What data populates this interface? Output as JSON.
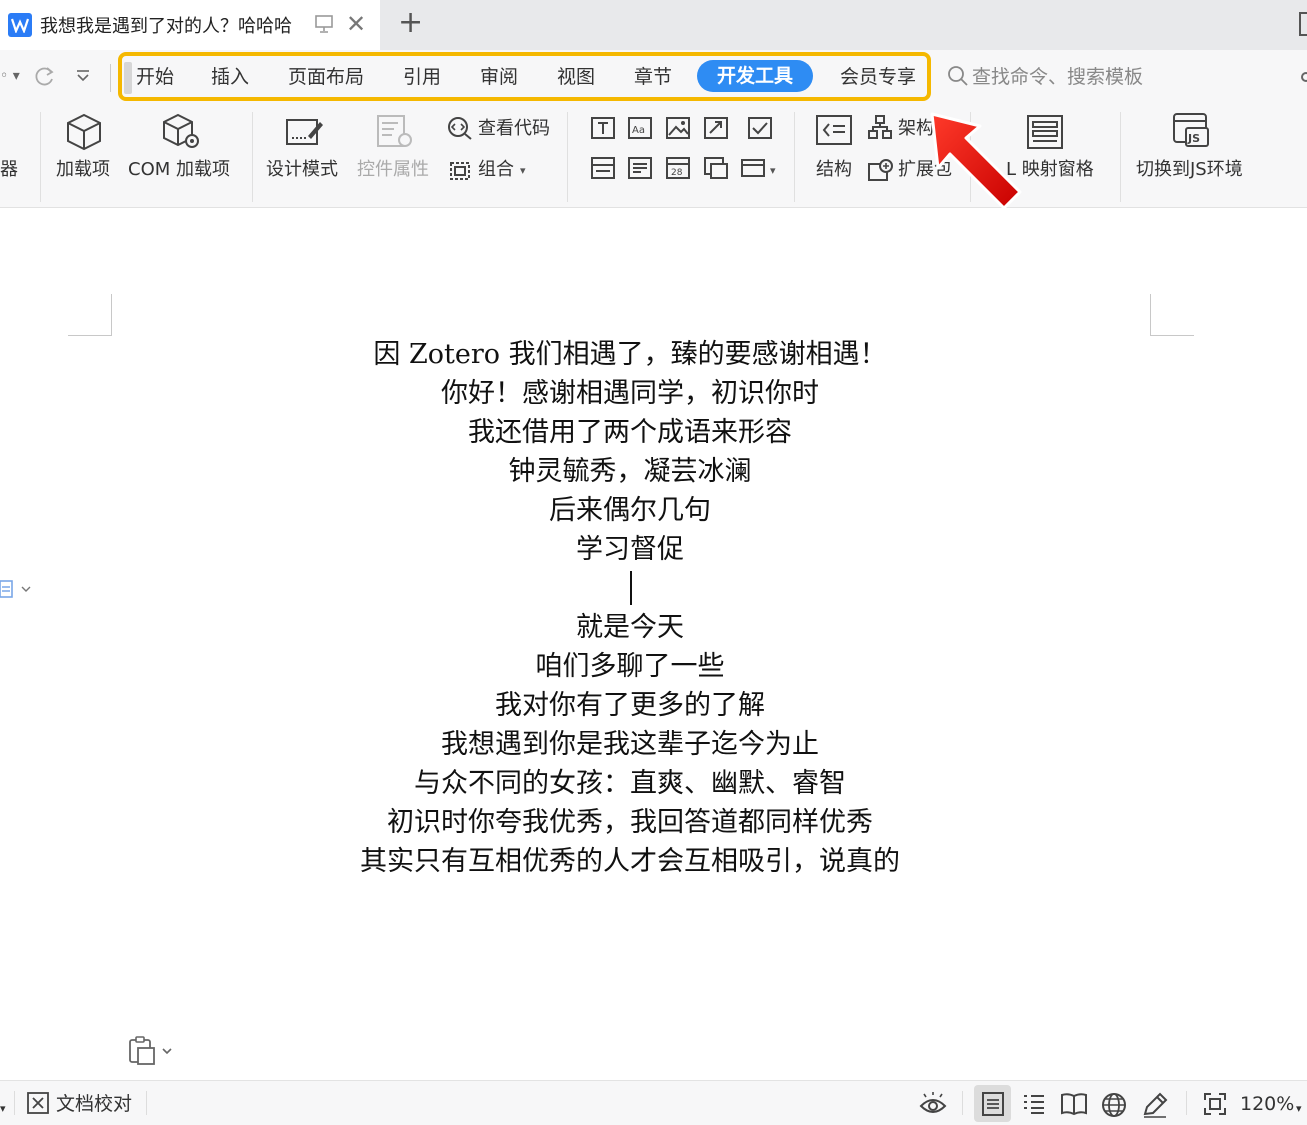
{
  "titlebar": {
    "doc_title": "我想我是遇到了对的人？哈哈哈",
    "app_icon_letter": "W"
  },
  "menu": {
    "items": [
      {
        "label": "开始"
      },
      {
        "label": "插入"
      },
      {
        "label": "页面布局"
      },
      {
        "label": "引用"
      },
      {
        "label": "审阅"
      },
      {
        "label": "视图"
      },
      {
        "label": "章节"
      },
      {
        "label": "开发工具",
        "active": true
      },
      {
        "label": "会员专享"
      }
    ],
    "search_placeholder": "查找命令、搜索模板"
  },
  "ribbon": {
    "left_partial": "器",
    "addins": "加载项",
    "com_addins": "COM 加载项",
    "design_mode": "设计模式",
    "control_props": "控件属性",
    "view_code": "查看代码",
    "group": "组合",
    "structure": "结构",
    "schema": "架构",
    "expansion_pack": "扩展包",
    "xml_pane": "L 映射窗格",
    "switch_js": "切换到JS环境"
  },
  "document": {
    "lines": [
      "因 Zotero 我们相遇了，臻的要感谢相遇！",
      "你好！感谢相遇同学，初识你时",
      "我还借用了两个成语来形容",
      "钟灵毓秀，凝芸冰澜",
      "后来偶尔几句",
      "学习督促",
      "就是今天",
      "咱们多聊了一些",
      "我对你有了更多的了解",
      "我想遇到你是我这辈子迄今为止",
      "与众不同的女孩：直爽、幽默、睿智",
      "初识时你夸我优秀，我回答道都同样优秀",
      "其实只有互相优秀的人才会互相吸引，说真的"
    ]
  },
  "statusbar": {
    "proofread": "文档校对",
    "zoom": "120%"
  },
  "colors": {
    "accent": "#2e8cf3",
    "highlight_border": "#f5b800",
    "arrow": "#e30000"
  }
}
